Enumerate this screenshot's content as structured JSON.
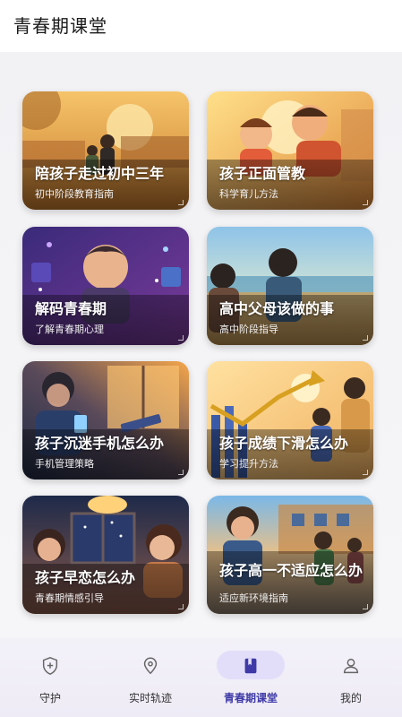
{
  "header": {
    "title": "青春期课堂"
  },
  "cards": [
    {
      "title": "陪孩子走过初中三年",
      "subtitle": "初中阶段教育指南"
    },
    {
      "title": "孩子正面管教",
      "subtitle": "科学育儿方法"
    },
    {
      "title": "解码青春期",
      "subtitle": "了解青春期心理"
    },
    {
      "title": "高中父母该做的事",
      "subtitle": "高中阶段指导"
    },
    {
      "title": "孩子沉迷手机怎么办",
      "subtitle": "手机管理策略"
    },
    {
      "title": "孩子成绩下滑怎么办",
      "subtitle": "学习提升方法"
    },
    {
      "title": "孩子早恋怎么办",
      "subtitle": "青春期情感引导"
    },
    {
      "title": "孩子高一不适应怎么办",
      "subtitle": "适应新环境指南"
    }
  ],
  "tabs": [
    {
      "label": "守护",
      "icon": "shield-plus-icon",
      "active": false
    },
    {
      "label": "实时轨迹",
      "icon": "location-pin-icon",
      "active": false
    },
    {
      "label": "青春期课堂",
      "icon": "book-icon",
      "active": true
    },
    {
      "label": "我的",
      "icon": "user-icon",
      "active": false
    }
  ],
  "colors": {
    "accent": "#3f3aa7",
    "active_pill": "#e2defa",
    "tabbar": "#f1eef7"
  }
}
